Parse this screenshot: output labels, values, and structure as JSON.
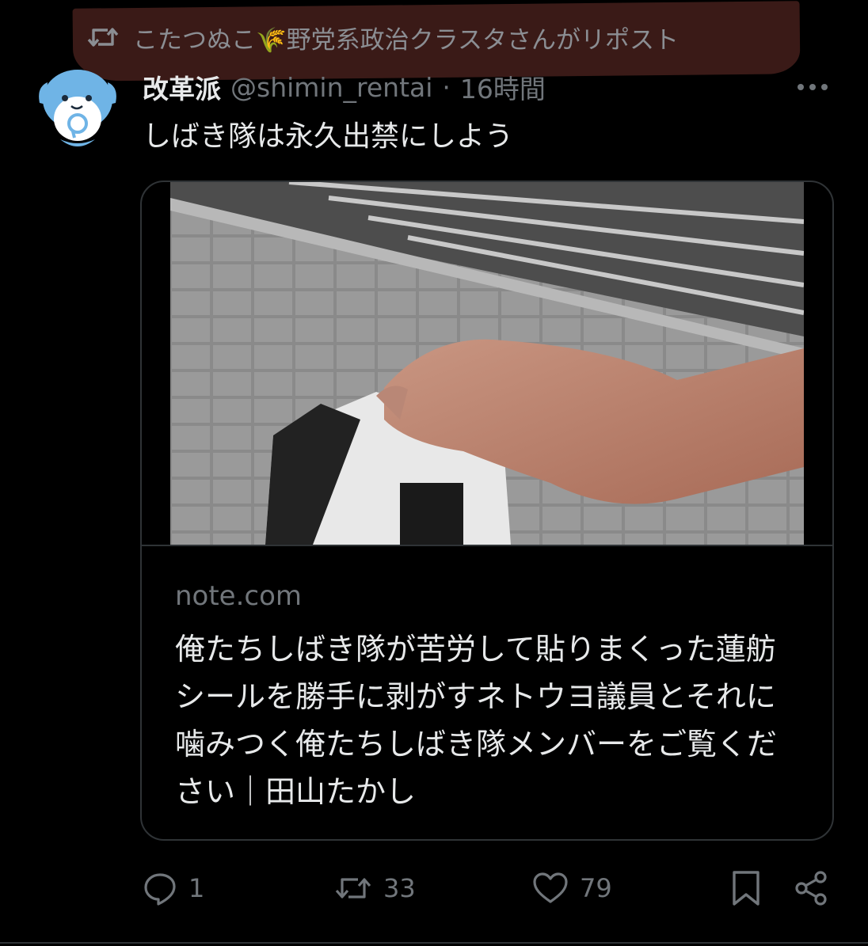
{
  "repost": {
    "text": "こたつぬこ🌾野党系政治クラスタさんがリポスト"
  },
  "tweet": {
    "display_name": "改革派",
    "handle": "@shimin_rentai",
    "separator": "·",
    "time": "16時間",
    "text": "しばき隊は永久出禁にしよう"
  },
  "card": {
    "domain": "note.com",
    "title": "俺たちしばき隊が苦労して貼りまくった蓮舫シールを勝手に剥がすネトウヨ議員とそれに噛みつく俺たちしばき隊メンバーをご覧ください｜田山たかし"
  },
  "actions": {
    "reply_count": "1",
    "retweet_count": "33",
    "like_count": "79"
  },
  "icons": {
    "repost": "repost-icon",
    "more": "more-icon",
    "reply": "reply-icon",
    "retweet": "retweet-icon",
    "like": "heart-icon",
    "bookmark": "bookmark-icon",
    "share": "share-icon"
  },
  "colors": {
    "background": "#000000",
    "text": "#e7e9ea",
    "muted": "#71767b",
    "border": "#2f3336",
    "banner": "#3a1a17"
  }
}
